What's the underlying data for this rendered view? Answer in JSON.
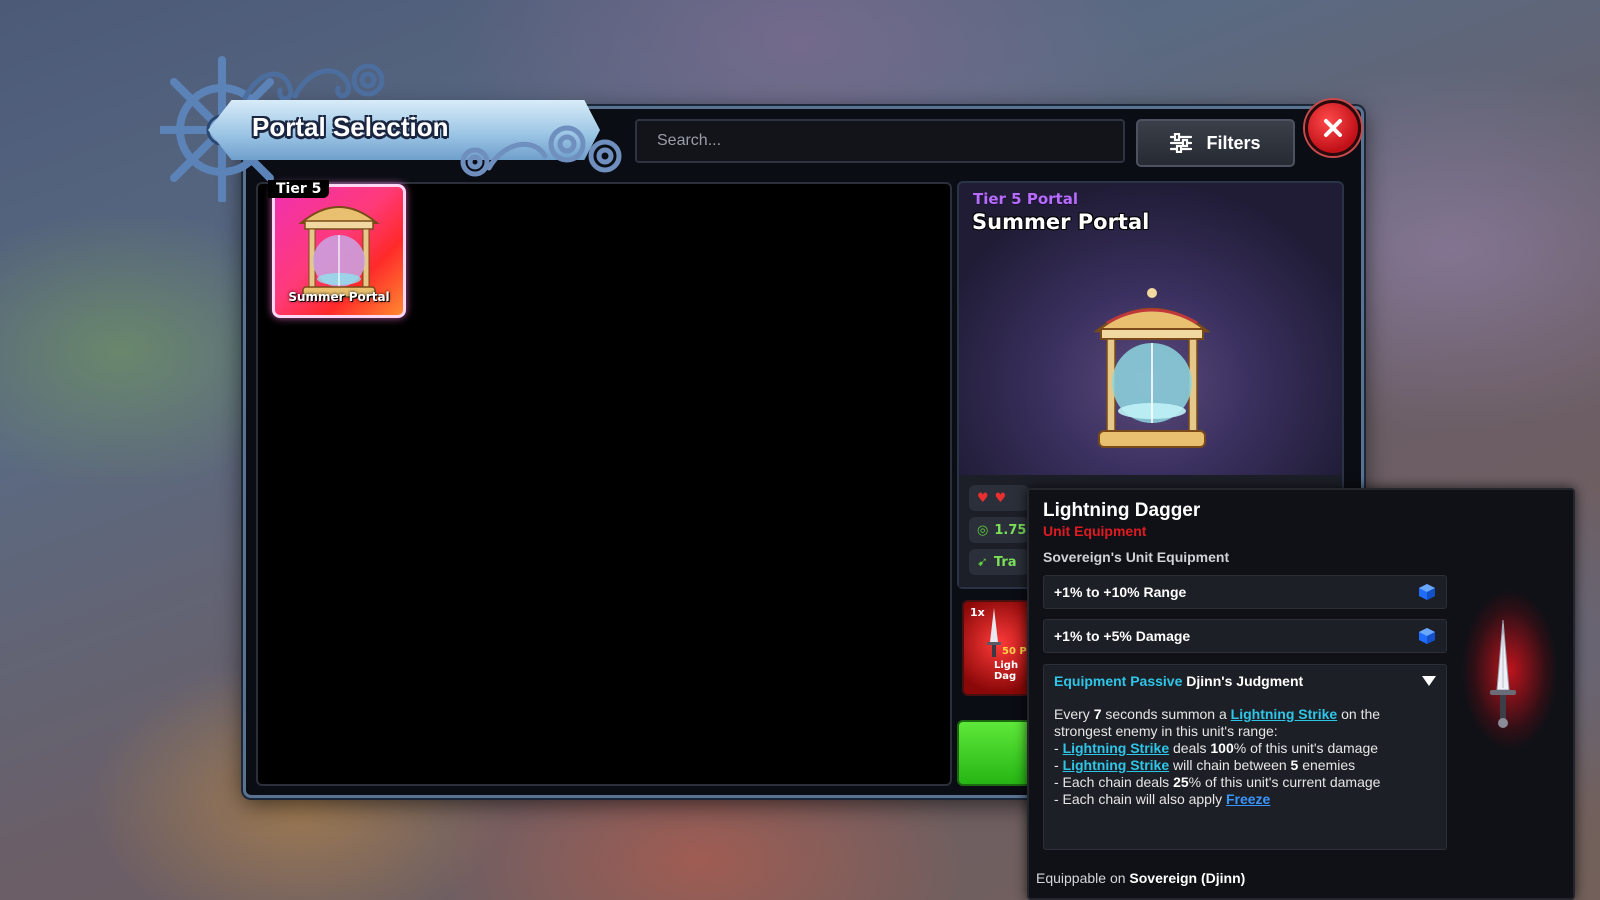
{
  "header": {
    "title": "Portal Selection",
    "search_placeholder": "Search...",
    "filters_label": "Filters"
  },
  "grid": {
    "items": [
      {
        "tier_tag": "Tier 5",
        "label": "Summer Portal"
      }
    ]
  },
  "detail": {
    "tier_label": "Tier 5 Portal",
    "name": "Summer Portal",
    "stat_peek_1": "1.75",
    "stat_peek_2": "Tra",
    "reward_count": "1x",
    "reward_peek": "50 P",
    "reward_peek_name": "Ligh Dag"
  },
  "tooltip": {
    "name": "Lightning Dagger",
    "type": "Unit Equipment",
    "group": "Sovereign's Unit Equipment",
    "stats": [
      {
        "value": "+1% to +10%",
        "label": "Range"
      },
      {
        "value": "+1% to +5%",
        "label": "Damage"
      }
    ],
    "passive": {
      "prefix": "Equipment Passive",
      "name": "Djinn's Judgment",
      "line1_a": "Every ",
      "line1_num": "7",
      "line1_b": " seconds summon a ",
      "keyword": "Lightning Strike",
      "line1_c": " on the strongest enemy in this unit's range:",
      "line2_a": "- ",
      "line2_b": " deals ",
      "line2_num": "100",
      "line2_c": "% of this unit's damage",
      "line3_a": "- ",
      "line3_b": " will chain between ",
      "line3_num": "5",
      "line3_c": " enemies",
      "line4_a": "- Each chain deals ",
      "line4_num": "25",
      "line4_b": "% of this unit's current damage",
      "line5_a": "- Each chain will also apply ",
      "line5_kw": "Freeze"
    },
    "equippable_prefix": "Equippable on ",
    "equippable_unit": "Sovereign (Djinn)"
  },
  "colors": {
    "tier_purple": "#b66cff",
    "unit_equipment_red": "#e11a22",
    "keyword_cyan": "#2ec6e8",
    "freeze_blue": "#3a96ff",
    "close_red": "#d0141c",
    "open_green": "#3fd52a"
  },
  "icons": {
    "filters": "sliders-icon",
    "close": "close-x-icon",
    "stat_gem": "blue-cube-icon",
    "dropdown": "caret-down-icon"
  }
}
